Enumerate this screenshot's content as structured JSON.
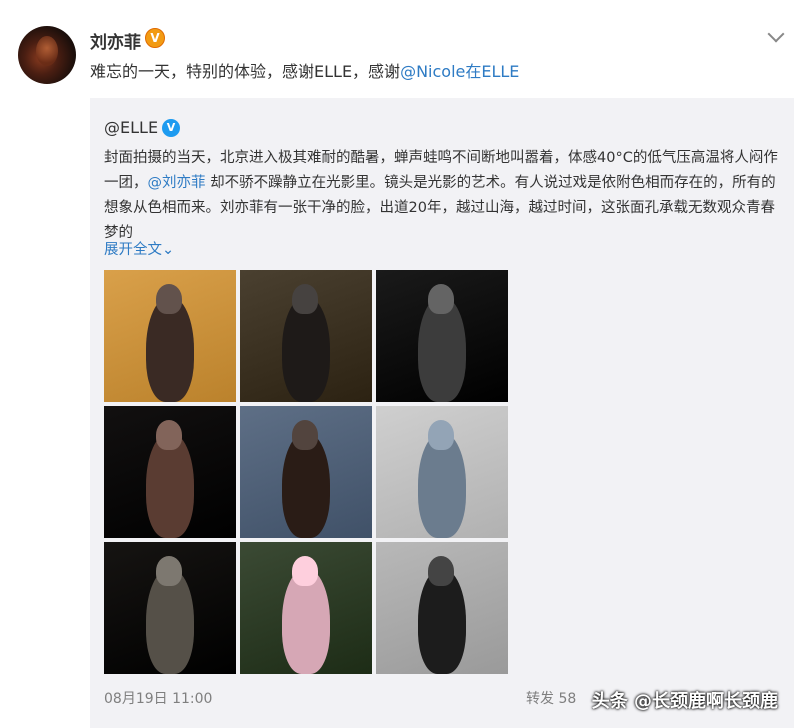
{
  "post": {
    "author": "刘亦菲",
    "verified_badge": "V",
    "text_before": "难忘的一天，特别的体验，感谢ELLE，感谢",
    "mention": "@Nicole在ELLE"
  },
  "repost": {
    "author": "@ELLE",
    "verified_badge": "V",
    "body_part1": "封面拍摄的当天，北京进入极其难耐的酷暑，蝉声蛙鸣不间断地叫嚣着，体感40°C的低气压高温将人闷作一团，",
    "body_mention": "@刘亦菲",
    "body_part2": " 却不骄不躁静立在光影里。镜头是光影的艺术。有人说过戏是依附色相而存在的，所有的想象从色相而来。刘亦菲有一张干净的脸，出道20年，越过山海，越过时间，这张面孔承载无数观众青春梦的",
    "expand": "展开全文",
    "date": "08月19日 11:00",
    "repost_label": "转发",
    "repost_count": "58"
  },
  "photos": [
    {
      "name": "photo-1",
      "bg": "#d9a04a",
      "fig": "#3a2a24"
    },
    {
      "name": "photo-2",
      "bg": "#4a4030",
      "fig": "#1e1a18"
    },
    {
      "name": "photo-3",
      "bg": "#1a1a1a",
      "fig": "#3c3c3c"
    },
    {
      "name": "photo-4",
      "bg": "#121010",
      "fig": "#5a3c32"
    },
    {
      "name": "photo-5",
      "bg": "#5e6f86",
      "fig": "#2a1c16"
    },
    {
      "name": "photo-6",
      "bg": "#cfcfcf",
      "fig": "#6b7c8e"
    },
    {
      "name": "photo-7",
      "bg": "#161412",
      "fig": "#555048"
    },
    {
      "name": "photo-8",
      "bg": "#3b4a34",
      "fig": "#d6a7b5"
    },
    {
      "name": "photo-9",
      "bg": "#b8b8b8",
      "fig": "#1c1c1c"
    }
  ],
  "watermark": "头条 @长颈鹿啊长颈鹿"
}
